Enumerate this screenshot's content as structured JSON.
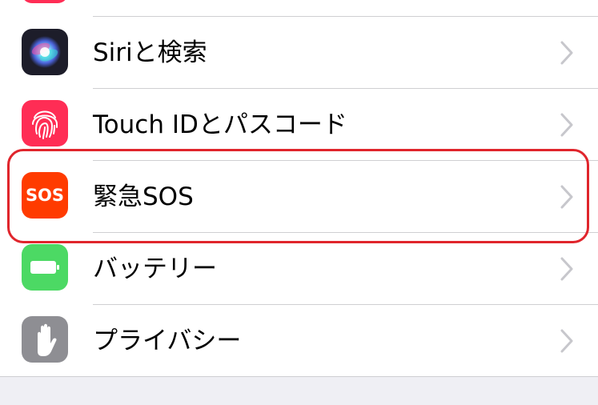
{
  "settings_items": [
    {
      "label": "Siriと検索",
      "icon": "siri-icon"
    },
    {
      "label": "Touch IDとパスコード",
      "icon": "fingerprint-icon",
      "icon_bg": "#ff2d55"
    },
    {
      "label": "緊急SOS",
      "icon": "sos-icon",
      "icon_text": "SOS",
      "icon_bg": "#ff3b00"
    },
    {
      "label": "バッテリー",
      "icon": "battery-icon",
      "icon_bg": "#4cd964"
    },
    {
      "label": "プライバシー",
      "icon": "hand-icon",
      "icon_bg": "#8e8e93"
    }
  ],
  "highlight_color": "#e0252c"
}
